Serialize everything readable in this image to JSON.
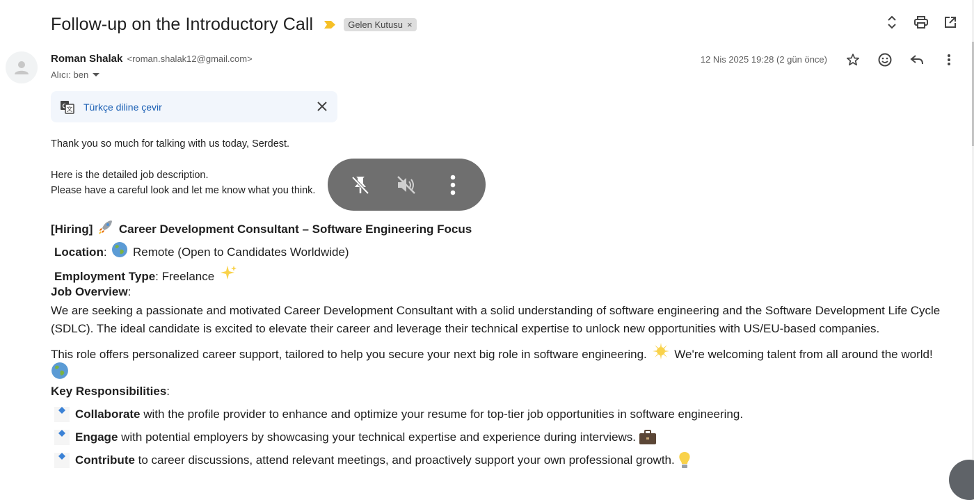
{
  "header": {
    "subject": "Follow-up on the Introductory Call",
    "label": "Gelen Kutusu",
    "label_remove": "×",
    "actions": [
      "expand-collapse-icon",
      "print-icon",
      "open-in-new-window-icon"
    ]
  },
  "message": {
    "sender_name": "Roman Shalak",
    "sender_email": "<roman.shalak12@gmail.com>",
    "recipient": "Alıcı: ben",
    "datetime": "12 Nis 2025 19:28 (2 gün önce)",
    "actions": [
      "star-icon",
      "emoji-reaction-icon",
      "reply-icon",
      "more-vert-icon"
    ]
  },
  "translate": {
    "link": "Türkçe diline çevir"
  },
  "intro": {
    "line1": "Thank you so much for talking with us today, Serdest.",
    "line2": "Here is the detailed job description.",
    "line3": "Please have a careful look and let me know what you think."
  },
  "overlay": {
    "buttons": [
      "unpin-icon",
      "mute-icon",
      "more-vert-icon"
    ],
    "bg_color": "#6f6f6f"
  },
  "job": {
    "hiring_tag": "[Hiring]",
    "title": "Career Development Consultant – Software Engineering Focus",
    "location_label": "Location",
    "location_value": "Remote (Open to Candidates Worldwide)",
    "type_label": "Employment Type",
    "type_value": "Freelance",
    "overview_heading": "Job Overview",
    "overview_p1": " We are seeking a passionate and motivated Career Development Consultant with a solid understanding of software engineering and the Software Development Life Cycle (SDLC). The ideal candidate is excited to elevate their career and leverage their technical expertise to unlock new opportunities with US/EU-based companies.",
    "overview_p2a": "This role offers personalized career support, tailored to help you secure your next big role in software engineering.",
    "overview_p2b": "We're welcoming talent from all around the world!",
    "responsibilities_heading": "Key Responsibilities",
    "responsibilities": [
      {
        "bold": "Collaborate",
        "text": " with the profile provider to enhance and optimize your resume for top-tier job opportunities in software engineering."
      },
      {
        "bold": "Engage",
        "text": " with potential employers by showcasing your technical expertise and experience during interviews."
      },
      {
        "bold": "Contribute",
        "text": " to career discussions, attend relevant meetings, and proactively support your own professional growth."
      }
    ]
  },
  "colors": {
    "link_blue": "#1a5fb4",
    "translate_bg": "#f2f6fc",
    "chip_bg": "#dddddd",
    "importance_marker": "#f6c026"
  }
}
